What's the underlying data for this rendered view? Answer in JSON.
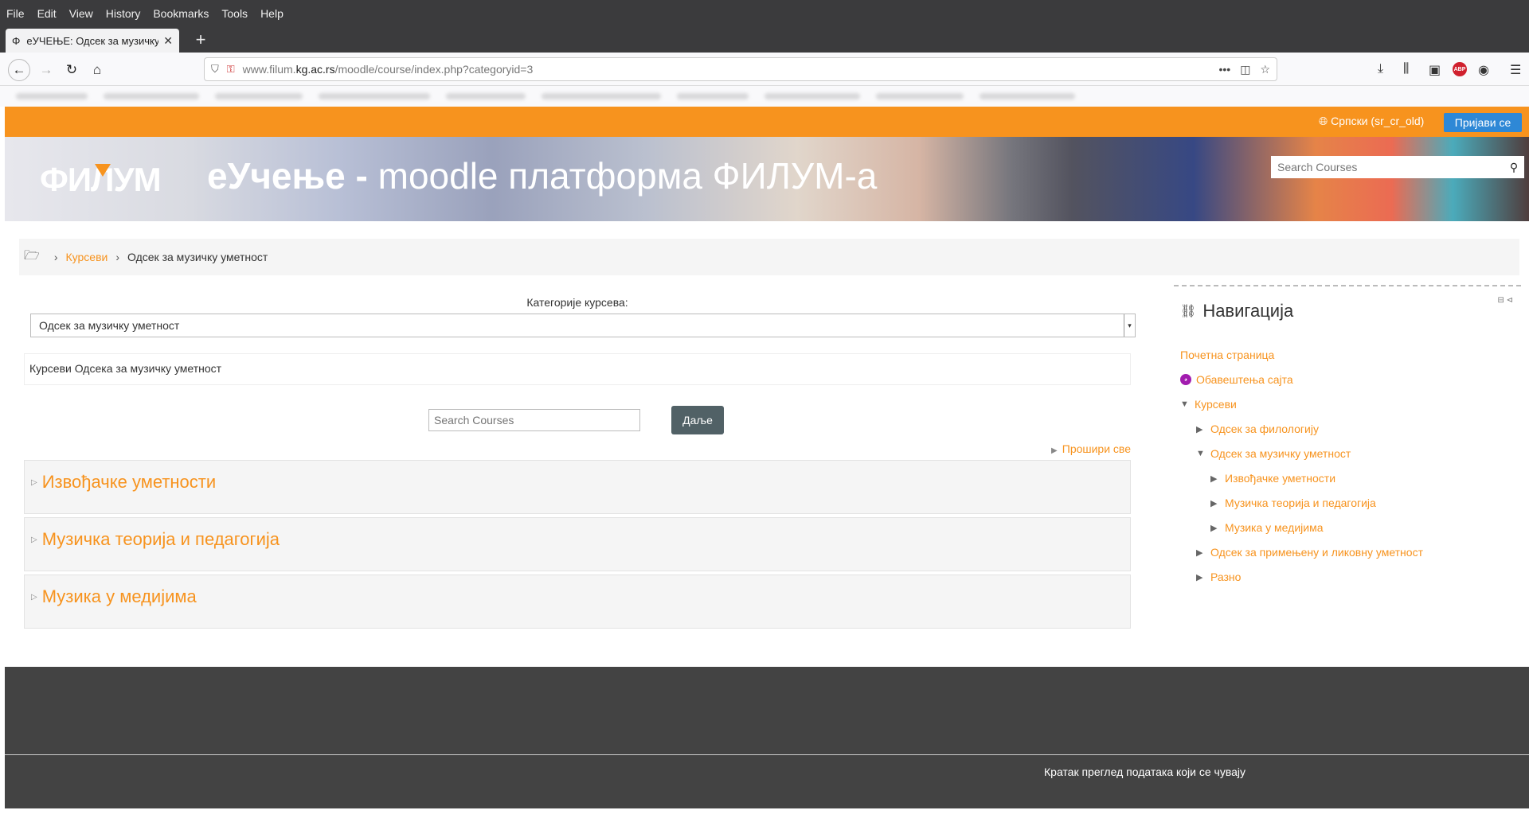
{
  "browser": {
    "menu": [
      "File",
      "Edit",
      "View",
      "History",
      "Bookmarks",
      "Tools",
      "Help"
    ],
    "tab_title": "еУЧЕЊЕ: Одсек за музичку",
    "tab_close": "✕",
    "new_tab": "+",
    "url_host_prefix": "www.filum.",
    "url_host_main": "kg.ac.rs",
    "url_path": "/moodle/course/index.php?categoryid=3"
  },
  "header": {
    "language": "Српски (sr_cr_old)",
    "login_label": "Пријави се",
    "logo": "ФИЛУМ",
    "site_title_bold": "еУчење -",
    "site_title_rest": " moodle платформа ФИЛУМ-а",
    "search_placeholder": "Search Courses"
  },
  "breadcrumb": {
    "courses": "Курсеви",
    "current": "Одсек за музичку уметност"
  },
  "main": {
    "categories_label": "Категорије курсева:",
    "selected_category": "Одсек за музичку уметност",
    "description": "Курсеви Одсека за музичку уметност",
    "search_placeholder": "Search Courses",
    "go_label": "Даље",
    "expand_all": "Прошири све",
    "categories": [
      {
        "name": "Извођачке уметности"
      },
      {
        "name": "Музичка теорија и педагогија"
      },
      {
        "name": "Музика у медијима"
      }
    ]
  },
  "navigation": {
    "title": "Навигација",
    "items": [
      {
        "label": "Почетна страница"
      },
      {
        "label": "Обавештења сајта"
      },
      {
        "label": "Курсеви"
      },
      {
        "label": "Одсек за филологију"
      },
      {
        "label": "Одсек за музичку уметност"
      },
      {
        "label": "Извођачке уметности"
      },
      {
        "label": "Музичка теорија и педагогија"
      },
      {
        "label": "Музика у медијима"
      },
      {
        "label": "Одсек за примењену и ликовну уметност"
      },
      {
        "label": "Разно"
      }
    ]
  },
  "footer": {
    "data_retention": "Кратак преглед података који се чувају"
  },
  "colors": {
    "accent": "#f7931e",
    "button_blue": "#2e88d6",
    "button_dark": "#516166",
    "footer": "#434343"
  }
}
